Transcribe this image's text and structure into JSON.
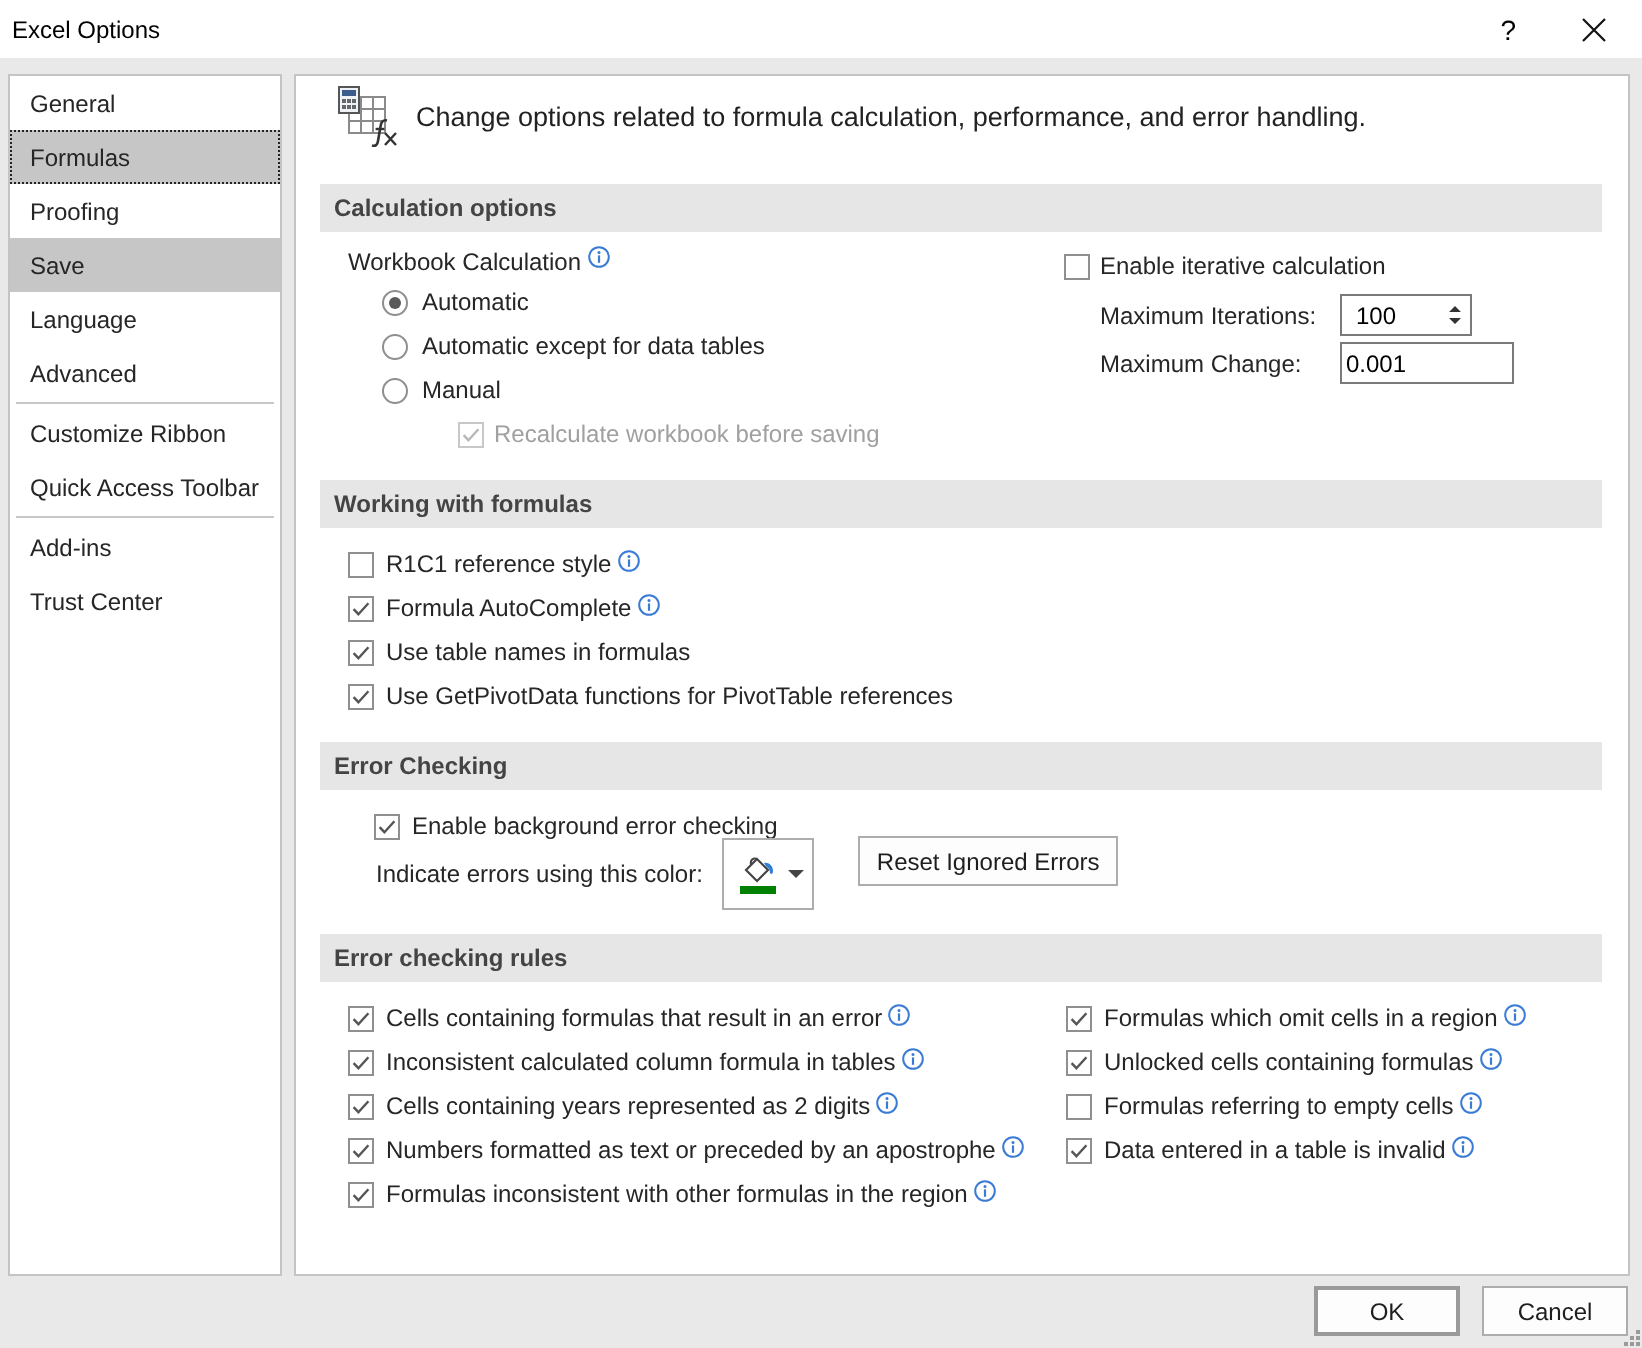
{
  "window": {
    "title": "Excel Options",
    "help": "?"
  },
  "sidebar": {
    "groups": [
      {
        "items": [
          {
            "label": "General",
            "selected": false,
            "hovered": false
          },
          {
            "label": "Formulas",
            "selected": true,
            "hovered": false
          },
          {
            "label": "Proofing",
            "selected": false,
            "hovered": false
          },
          {
            "label": "Save",
            "selected": false,
            "hovered": true
          },
          {
            "label": "Language",
            "selected": false,
            "hovered": false
          },
          {
            "label": "Advanced",
            "selected": false,
            "hovered": false
          }
        ]
      },
      {
        "items": [
          {
            "label": "Customize Ribbon",
            "selected": false,
            "hovered": false
          },
          {
            "label": "Quick Access Toolbar",
            "selected": false,
            "hovered": false
          }
        ]
      },
      {
        "items": [
          {
            "label": "Add-ins",
            "selected": false,
            "hovered": false
          },
          {
            "label": "Trust Center",
            "selected": false,
            "hovered": false
          }
        ]
      }
    ]
  },
  "header": {
    "text": "Change options related to formula calculation, performance, and error handling."
  },
  "calculation_options": {
    "title": "Calculation options",
    "workbook_calculation": {
      "label": "Workbook Calculation",
      "info": true
    },
    "modes": [
      {
        "label": "Automatic",
        "selected": true
      },
      {
        "label": "Automatic except for data tables",
        "selected": false
      },
      {
        "label": "Manual",
        "selected": false
      }
    ],
    "recalculate": {
      "label": "Recalculate workbook before saving",
      "checked": true,
      "disabled": true
    },
    "iterative": {
      "label": "Enable iterative calculation",
      "checked": false
    },
    "maximum_iterations": {
      "label": "Maximum Iterations:",
      "value": "100"
    },
    "maximum_change": {
      "label": "Maximum Change:",
      "value": "0.001"
    }
  },
  "working_with_formulas": {
    "title": "Working with formulas",
    "options": [
      {
        "label": "R1C1 reference style",
        "checked": false,
        "info": true
      },
      {
        "label": "Formula AutoComplete",
        "checked": true,
        "info": true
      },
      {
        "label": "Use table names in formulas",
        "checked": true
      },
      {
        "label": "Use GetPivotData functions for PivotTable references",
        "checked": true
      }
    ]
  },
  "error_checking": {
    "title": "Error Checking",
    "background": {
      "label": "Enable background error checking",
      "checked": true
    },
    "color_label": "Indicate errors using this color:",
    "color": "#008000",
    "reset_button": "Reset Ignored Errors"
  },
  "error_checking_rules": {
    "title": "Error checking rules",
    "columns": [
      {
        "rules": [
          {
            "label": "Cells containing formulas that result in an error",
            "checked": true,
            "info": true
          },
          {
            "label": "Inconsistent calculated column formula in tables",
            "checked": true,
            "info": true
          },
          {
            "label": "Cells containing years represented as 2 digits",
            "checked": true,
            "info": true
          },
          {
            "label": "Numbers formatted as text or preceded by an apostrophe",
            "checked": true,
            "info": true
          },
          {
            "label": "Formulas inconsistent with other formulas in the region",
            "checked": true,
            "info": true
          }
        ]
      },
      {
        "rules": [
          {
            "label": "Formulas which omit cells in a region",
            "checked": true,
            "info": true
          },
          {
            "label": "Unlocked cells containing formulas",
            "checked": true,
            "info": true
          },
          {
            "label": "Formulas referring to empty cells",
            "checked": false,
            "info": true
          },
          {
            "label": "Data entered in a table is invalid",
            "checked": true,
            "info": true
          }
        ]
      }
    ]
  },
  "buttons": [
    {
      "label": "OK",
      "default": true
    },
    {
      "label": "Cancel",
      "default": false
    }
  ]
}
